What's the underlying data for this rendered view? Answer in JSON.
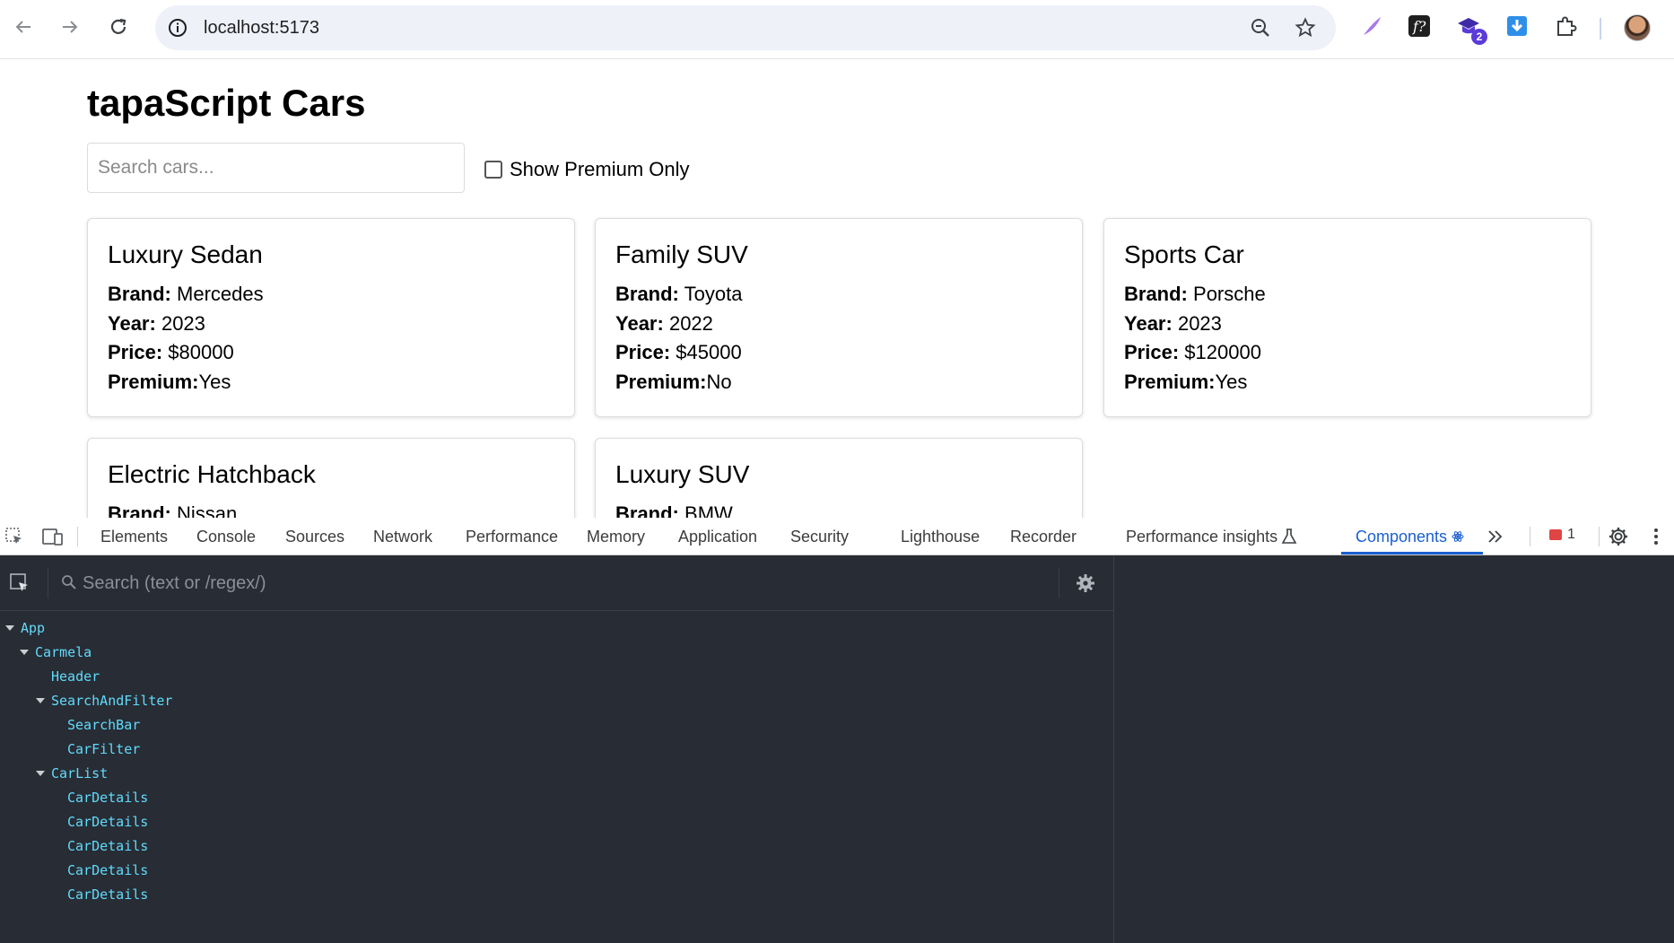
{
  "browser": {
    "url": "localhost:5173",
    "extension_badge": "2"
  },
  "page": {
    "title": "tapaScript Cars",
    "search_placeholder": "Search cars...",
    "premium_label": "Show Premium Only",
    "field_labels": {
      "brand": "Brand:",
      "year": "Year:",
      "price": "Price:",
      "premium": "Premium:"
    },
    "cars": [
      {
        "name": "Luxury Sedan",
        "brand": "Mercedes",
        "year": "2023",
        "price": "$80000",
        "premium": "Yes"
      },
      {
        "name": "Family SUV",
        "brand": "Toyota",
        "year": "2022",
        "price": "$45000",
        "premium": "No"
      },
      {
        "name": "Sports Car",
        "brand": "Porsche",
        "year": "2023",
        "price": "$120000",
        "premium": "Yes"
      },
      {
        "name": "Electric Hatchback",
        "brand": "Nissan",
        "year": "",
        "price": "",
        "premium": ""
      },
      {
        "name": "Luxury SUV",
        "brand": "BMW",
        "year": "",
        "price": "",
        "premium": ""
      }
    ]
  },
  "devtools": {
    "tabs": [
      "Elements",
      "Console",
      "Sources",
      "Network",
      "Performance",
      "Memory",
      "Application",
      "Security",
      "Lighthouse",
      "Recorder",
      "Performance insights",
      "Components"
    ],
    "active_tab": "Components",
    "error_count": "1",
    "search_placeholder": "Search (text or /regex/)",
    "tree": [
      "App",
      "Carmela",
      "Header",
      "SearchAndFilter",
      "SearchBar",
      "CarFilter",
      "CarList",
      "CarDetails",
      "CarDetails",
      "CarDetails",
      "CarDetails",
      "CarDetails"
    ]
  }
}
